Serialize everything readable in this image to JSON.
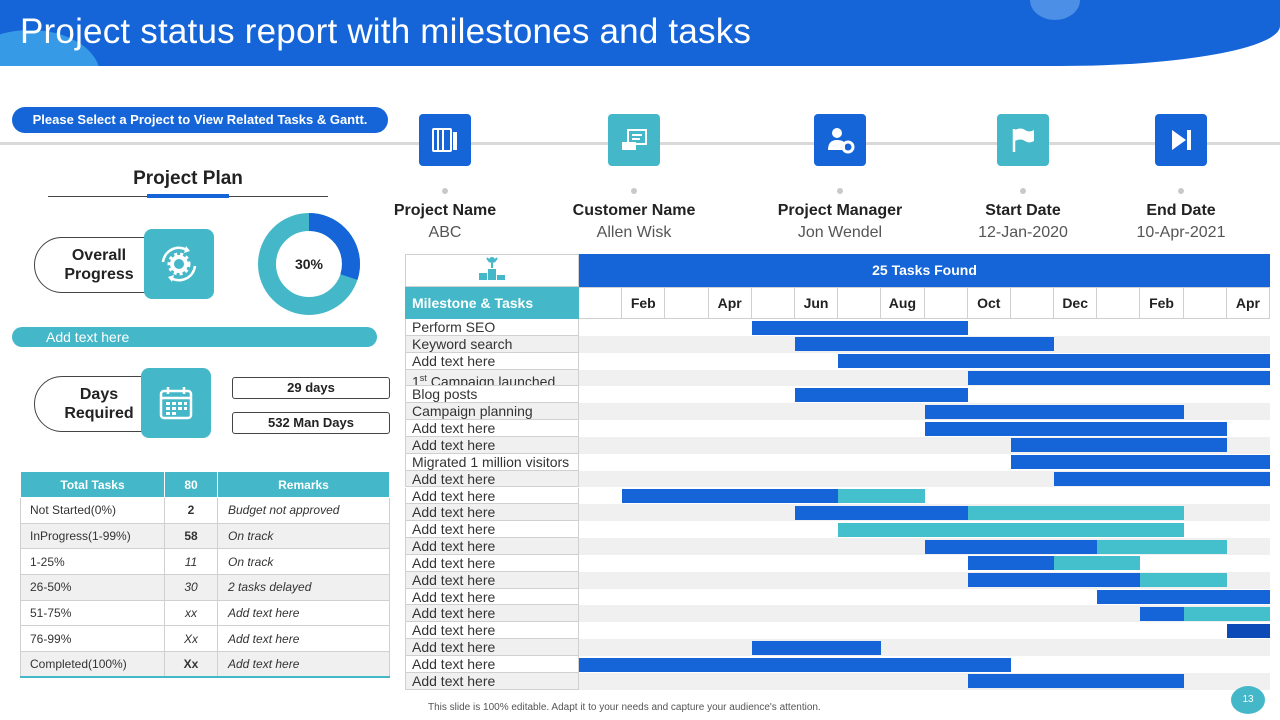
{
  "header": {
    "title": "Project status report with milestones and tasks"
  },
  "select_prompt": "Please Select a Project to View Related Tasks & Gantt.",
  "project_info": [
    {
      "label": "Project Name",
      "value": "ABC",
      "icon": "document-icon",
      "style": "dark"
    },
    {
      "label": "Customer Name",
      "value": "Allen Wisk",
      "icon": "customer-card-icon",
      "style": "light"
    },
    {
      "label": "Project Manager",
      "value": "Jon Wendel",
      "icon": "manager-gear-icon",
      "style": "dark"
    },
    {
      "label": "Start Date",
      "value": "12-Jan-2020",
      "icon": "flag-icon",
      "style": "light"
    },
    {
      "label": "End Date",
      "value": "10-Apr-2021",
      "icon": "skip-end-icon",
      "style": "dark"
    }
  ],
  "plan": {
    "title": "Project Plan",
    "overall_label": "Overall Progress",
    "progress_text": "30%",
    "progress_fraction": 0.3,
    "add_text": "Add text here",
    "days_label": "Days Required",
    "days": "29 days",
    "man_days": "532 Man Days"
  },
  "status_table": {
    "headers": [
      "Total Tasks",
      "80",
      "Remarks"
    ],
    "rows": [
      {
        "label": "Not Started(0%)",
        "count": "2",
        "remark": "Budget not approved"
      },
      {
        "label": "InProgress(1-99%)",
        "count": "58",
        "remark": "On track"
      },
      {
        "label": "1-25%",
        "count": "11",
        "remark": "On track"
      },
      {
        "label": "26-50%",
        "count": "30",
        "remark": "2 tasks delayed"
      },
      {
        "label": "51-75%",
        "count": "xx",
        "remark": "Add text here"
      },
      {
        "label": "76-99%",
        "count": "Xx",
        "remark": "Add text here"
      },
      {
        "label": "Completed(100%)",
        "count": "Xx",
        "remark": "Add text here"
      }
    ]
  },
  "gantt": {
    "found_text": "25 Tasks Found",
    "milestone_header": "Milestone & Tasks",
    "months": [
      "",
      "Feb",
      "",
      "Apr",
      "",
      "Jun",
      "",
      "Aug",
      "",
      "Oct",
      "",
      "Dec",
      "",
      "Feb",
      "",
      "Apr"
    ],
    "colors": {
      "dark": "#1565d8",
      "light": "#44c0cc",
      "navy": "#0c4ab8"
    },
    "tasks": [
      {
        "label": "Perform SEO",
        "bars": [
          [
            4,
            9,
            "dark"
          ]
        ]
      },
      {
        "label": "Keyword search",
        "bars": [
          [
            5,
            11,
            "dark"
          ]
        ]
      },
      {
        "label": "Add text here",
        "bars": [
          [
            6,
            16,
            "dark"
          ]
        ]
      },
      {
        "label": "Campaign launched",
        "prefix": "1",
        "sup": "st",
        "bars": [
          [
            9,
            16,
            "dark"
          ]
        ]
      },
      {
        "label": "Blog posts",
        "bars": [
          [
            5,
            9,
            "dark"
          ]
        ]
      },
      {
        "label": "Campaign planning",
        "bars": [
          [
            8,
            14,
            "dark"
          ]
        ]
      },
      {
        "label": "Add text here",
        "bars": [
          [
            8,
            15,
            "dark"
          ]
        ]
      },
      {
        "label": "Add text here",
        "bars": [
          [
            10,
            15,
            "dark"
          ]
        ]
      },
      {
        "label": "Migrated 1 million visitors",
        "bars": [
          [
            10,
            16,
            "dark"
          ]
        ]
      },
      {
        "label": "Add text here",
        "bars": [
          [
            11,
            16,
            "dark"
          ]
        ]
      },
      {
        "label": "Add text here",
        "bars": [
          [
            1,
            6,
            "dark"
          ],
          [
            6,
            8,
            "light"
          ]
        ]
      },
      {
        "label": "Add text here",
        "bars": [
          [
            5,
            9,
            "dark"
          ],
          [
            9,
            14,
            "light"
          ]
        ]
      },
      {
        "label": "Add text here",
        "bars": [
          [
            6,
            14,
            "light"
          ]
        ]
      },
      {
        "label": "Add text here",
        "bars": [
          [
            8,
            12,
            "dark"
          ],
          [
            12,
            15,
            "light"
          ]
        ]
      },
      {
        "label": "Add text here",
        "bars": [
          [
            9,
            11,
            "dark"
          ],
          [
            11,
            13,
            "light"
          ]
        ]
      },
      {
        "label": "Add text here",
        "bars": [
          [
            9,
            13,
            "dark"
          ],
          [
            13,
            15,
            "light"
          ]
        ]
      },
      {
        "label": "Add text here",
        "bars": [
          [
            12,
            16,
            "dark"
          ]
        ]
      },
      {
        "label": "Add text here",
        "bars": [
          [
            13,
            14,
            "dark"
          ],
          [
            14,
            16,
            "light"
          ]
        ]
      },
      {
        "label": "Add text here",
        "bars": [
          [
            15,
            16,
            "navy"
          ]
        ]
      },
      {
        "label": "Add text here",
        "bars": [
          [
            4,
            7,
            "dark"
          ]
        ]
      },
      {
        "label": "Add text here",
        "bars": [
          [
            0,
            10,
            "dark"
          ]
        ]
      },
      {
        "label": "Add text here",
        "bars": [
          [
            9,
            14,
            "dark"
          ]
        ]
      }
    ]
  },
  "footer": {
    "note": "This slide is 100% editable. Adapt it to your needs and capture your audience's attention.",
    "page": "13"
  }
}
